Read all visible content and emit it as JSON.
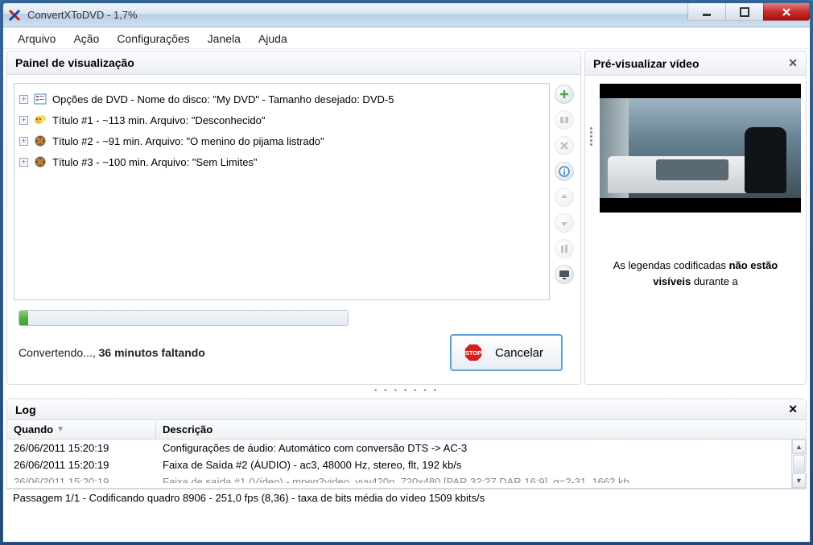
{
  "window": {
    "title": "ConvertXToDVD - 1,7%"
  },
  "menu": {
    "items": [
      "Arquivo",
      "Ação",
      "Configurações",
      "Janela",
      "Ajuda"
    ]
  },
  "visualization_panel": {
    "title": "Painel de visualização"
  },
  "tree": {
    "dvd_options": "Opções de DVD - Nome do disco: \"My DVD\" - Tamanho desejado: DVD-5",
    "title1": "Título #1 - ~113 min. Arquivo: \"Desconhecido\"",
    "title2": "Título #2 - ~91 min. Arquivo: \"O menino do pijama listrado\"",
    "title3": "Título #3 - ~100 min. Arquivo: \"Sem Limites\""
  },
  "progress": {
    "percent": 1.7,
    "status_prefix": "Convertendo..., ",
    "status_bold": "36 minutos faltando",
    "cancel_label": "Cancelar"
  },
  "preview": {
    "title": "Pré-visualizar vídeo",
    "caption_line1": "As legendas codificadas ",
    "caption_bold": "não estão visíveis",
    "caption_line2": " durante a"
  },
  "log": {
    "title": "Log",
    "col_when": "Quando",
    "col_desc": "Descrição",
    "rows": [
      {
        "when": "26/06/2011 15:20:19",
        "desc": "Configurações de áudio: Automático com conversão DTS -> AC-3"
      },
      {
        "when": "26/06/2011 15:20:19",
        "desc": "Faixa de Saída #2 (ÁUDIO) - ac3, 48000 Hz, stereo, flt, 192 kb/s"
      },
      {
        "when": "26/06/2011 15:20:19",
        "desc": "Faixa de saída #1 (Vídeo) - mpeg2video, yuv420p, 720x480 [PAR 32:27 DAR 16:9], q=2-31, 1662 kb"
      }
    ]
  },
  "statusbar": {
    "text": "Passagem 1/1 - Codificando quadro 8906 - 251,0 fps (8,36) - taxa de bits média do vídeo 1509 kbits/s"
  }
}
